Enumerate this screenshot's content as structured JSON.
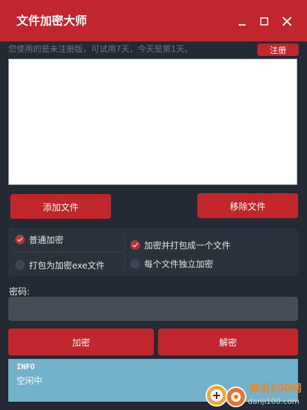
{
  "window": {
    "title": "文件加密大师",
    "controls": [
      "minimize-icon",
      "maximize-icon",
      "close-icon"
    ]
  },
  "notice": {
    "text": "您使用的是未注册版，可试用7天，今天是第1天。",
    "register_label": "注册"
  },
  "file_list": {
    "items": []
  },
  "buttons": {
    "add_file": "添加文件",
    "remove_file": "移除文件",
    "encrypt": "加密",
    "decrypt": "解密"
  },
  "options": {
    "normal": {
      "label": "普通加密",
      "checked": true
    },
    "pack_exe": {
      "label": "打包为加密exe文件",
      "checked": false
    },
    "merge": {
      "label": "加密并打包成一个文件",
      "checked": true
    },
    "independent": {
      "label": "每个文件独立加密",
      "checked": false
    }
  },
  "password": {
    "label": "密码:",
    "value": ""
  },
  "info": {
    "title": "INFO",
    "status": "空闲中"
  },
  "watermark": {
    "name": "单机100网",
    "url": "danji100.com"
  },
  "colors": {
    "accent": "#c0262b",
    "background": "#232a33",
    "info_background": "#72b2cb",
    "watermark": "#e58a2f"
  }
}
